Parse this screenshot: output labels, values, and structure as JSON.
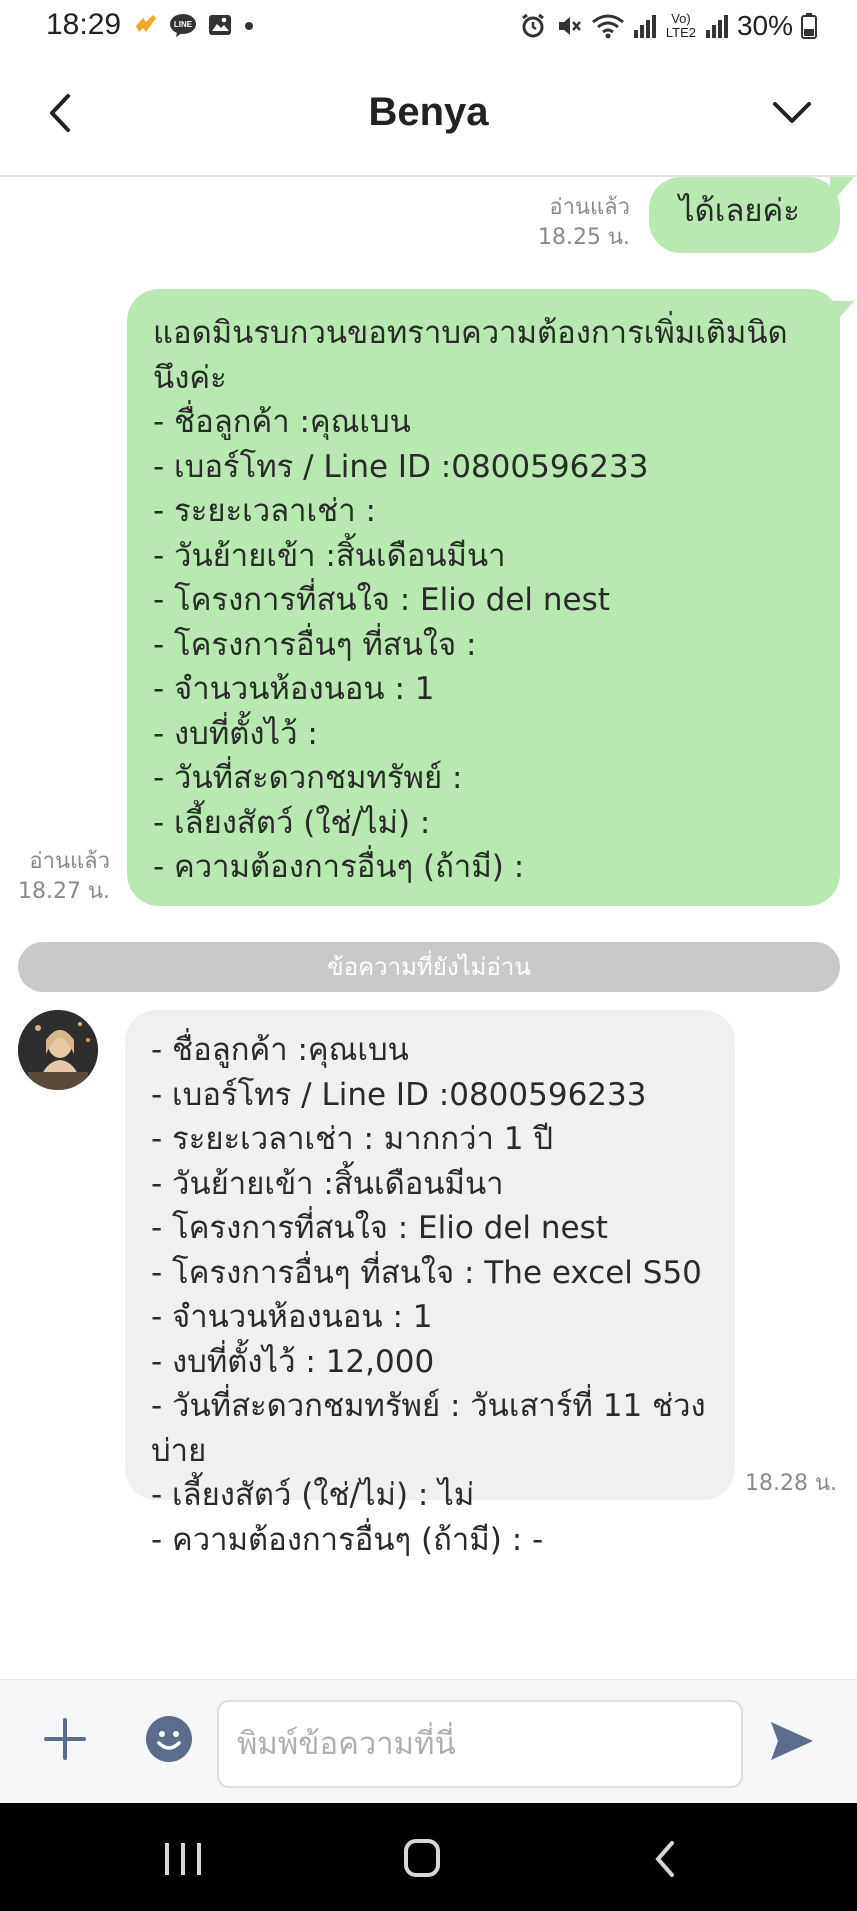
{
  "status_bar": {
    "time": "18:29",
    "battery": "30%",
    "signal_labels": "Vo) LTE2"
  },
  "header": {
    "title": "Benya"
  },
  "messages": [
    {
      "direction": "sent",
      "text": "ได้เลยค่ะ",
      "read_label": "อ่านแล้ว",
      "time": "18.25 น."
    },
    {
      "direction": "sent",
      "text": "แอดมินรบกวนขอทราบความต้องการเพิ่มเติมนิดนึงค่ะ\n- ชื่อลูกค้า :คุณเบน\n- เบอร์โทร / Line ID :0800596233\n- ระยะเวลาเช่า :\n- วันย้ายเข้า :สิ้นเดือนมีนา\n- โครงการที่สนใจ : Elio del nest\n- โครงการอื่นๆ ที่สนใจ :\n- จำนวนห้องนอน : 1\n- งบที่ตั้งไว้ :\n- วันที่สะดวกชมทรัพย์ :\n- เลี้ยงสัตว์ (ใช่/ไม่) :\n- ความต้องการอื่นๆ (ถ้ามี) :",
      "read_label": "อ่านแล้ว",
      "time": "18.27 น."
    },
    {
      "direction": "received",
      "text": "- ชื่อลูกค้า :คุณเบน\n- เบอร์โทร / Line ID :0800596233\n- ระยะเวลาเช่า : มากกว่า 1 ปี\n- วันย้ายเข้า :สิ้นเดือนมีนา\n- โครงการที่สนใจ : Elio del nest\n- โครงการอื่นๆ ที่สนใจ : The excel S50\n- จำนวนห้องนอน : 1\n- งบที่ตั้งไว้ : 12,000\n- วันที่สะดวกชมทรัพย์ : วันเสาร์ที่ 11 ช่วงบ่าย\n- เลี้ยงสัตว์ (ใช่/ไม่) : ไม่\n- ความต้องการอื่นๆ (ถ้ามี) : -",
      "time": "18.28 น."
    }
  ],
  "unread_divider": "ข้อความที่ยังไม่อ่าน",
  "input": {
    "placeholder": "พิมพ์ข้อความที่นี่"
  },
  "colors": {
    "sent_bubble": "#b7e9b0",
    "received_bubble": "#eff0f2",
    "icon_gray_blue": "#5b6c8d"
  },
  "icons": {
    "back": "chevron-left-icon",
    "menu": "chevron-down-icon",
    "plus": "plus-icon",
    "emoji": "emoji-icon",
    "send": "send-icon"
  }
}
